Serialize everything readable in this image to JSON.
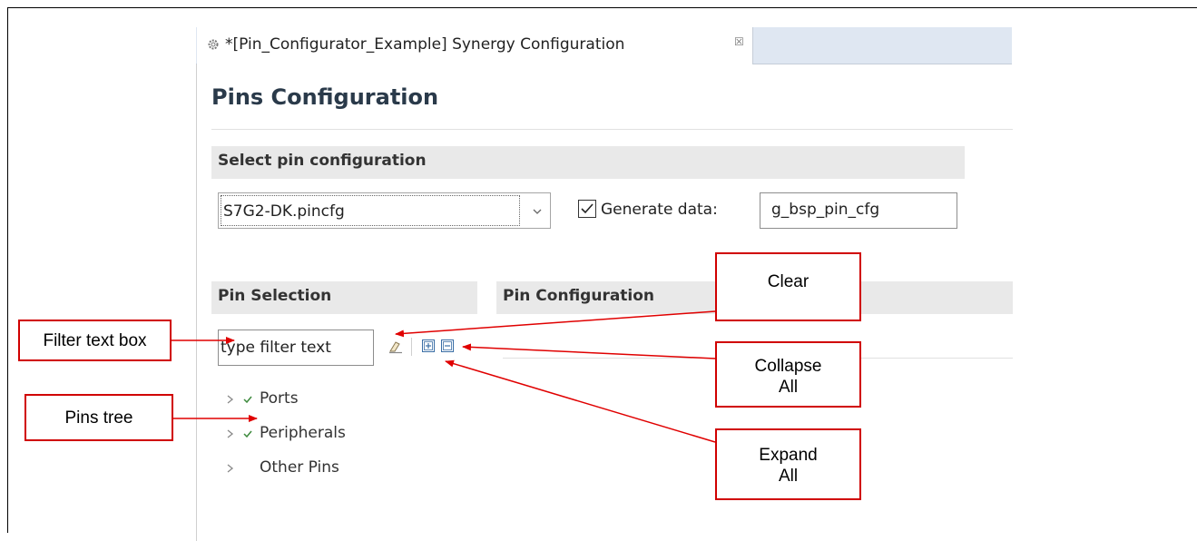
{
  "editor": {
    "tab_title": "*[Pin_Configurator_Example] Synergy Configuration",
    "tab_close": "☒",
    "page_title": "Pins Configuration"
  },
  "select_pin_configuration": {
    "heading": "Select pin configuration",
    "selected_value": "S7G2-DK.pincfg",
    "generate_data_checked": true,
    "generate_data_label": "Generate data:",
    "generate_data_value": "g_bsp_pin_cfg"
  },
  "pin_selection": {
    "heading": "Pin Selection",
    "filter_placeholder": "type filter text",
    "tree": [
      {
        "label": "Ports",
        "checked": true
      },
      {
        "label": "Peripherals",
        "checked": true
      },
      {
        "label": "Other Pins",
        "checked": false
      }
    ]
  },
  "pin_configuration": {
    "heading": "Pin Configuration"
  },
  "callouts": {
    "filter_text_box": "Filter text box",
    "pins_tree": "Pins tree",
    "clear": "Clear",
    "collapse_all_line1": "Collapse",
    "collapse_all_line2": "All",
    "expand_all_line1": "Expand",
    "expand_all_line2": "All"
  },
  "colors": {
    "callout_border": "#d00000",
    "tab_bar": "#dfe7f2",
    "section_header": "#e9e9e9"
  },
  "icons": [
    "gear-icon",
    "close-icon",
    "chevron-down-icon",
    "checkbox-icon",
    "eraser-icon",
    "expand-all-icon",
    "collapse-all-icon",
    "tree-expand-icon",
    "check-icon"
  ]
}
